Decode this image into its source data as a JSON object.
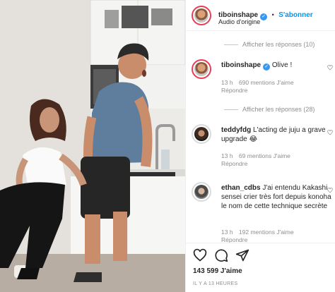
{
  "post": {
    "author": "tiboinshape",
    "verified": true,
    "follow_label": "S'abonner",
    "separator": "•",
    "audio": "Audio d'origine",
    "likes": "143 599 J'aime",
    "time": "IL Y A 13 HEURES"
  },
  "comments": {
    "reply_toggle_1": "Afficher les réponses (10)",
    "reply_toggle_2": "Afficher les réponses (28)",
    "items": [
      {
        "username": "tiboinshape",
        "text": "Olive !",
        "age": "13 h",
        "likes": "690 mentions J'aime",
        "reply": "Répondre"
      },
      {
        "username": "teddyfdg",
        "text": "L'acting de juju a grave upgrade 😂",
        "age": "13 h",
        "likes": "69 mentions J'aime",
        "reply": "Répondre"
      },
      {
        "username": "ethan_cdbs",
        "text": "J'ai entendu Kakashi sensei crier très fort depuis konoha le nom de cette technique secrète",
        "age": "13 h",
        "likes": "192 mentions J'aime",
        "reply": "Répondre"
      }
    ]
  },
  "icons": [
    "heart-icon",
    "comment-icon",
    "share-icon",
    "verified-icon"
  ],
  "colors": {
    "accent": "#0095f6",
    "story_ring": "#ea3d55",
    "muted": "#8e8e8e"
  }
}
